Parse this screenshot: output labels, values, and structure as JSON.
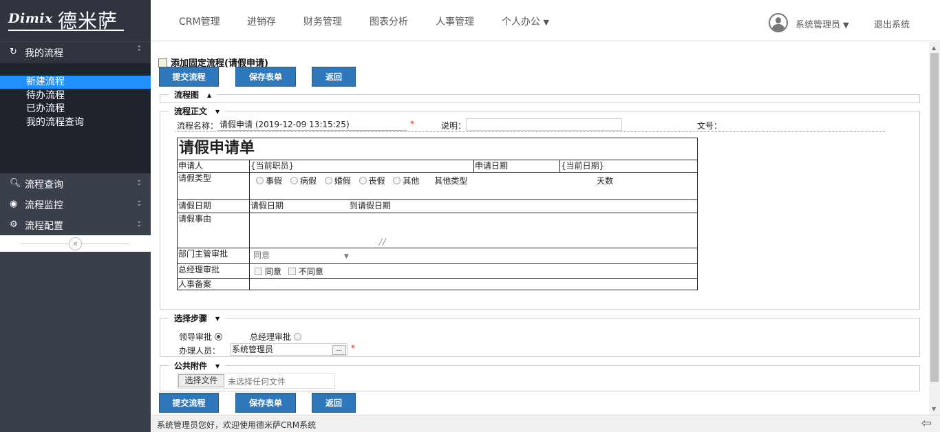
{
  "brand": {
    "logo_latin": "Dimix",
    "logo_cn": "德米萨"
  },
  "sidebar": {
    "my_flow": {
      "icon": "refresh-icon",
      "label": "我的流程"
    },
    "sub_items": [
      {
        "label": "新建流程",
        "active": true
      },
      {
        "label": "待办流程"
      },
      {
        "label": "已办流程"
      },
      {
        "label": "我的流程查询"
      }
    ],
    "sections": [
      {
        "icon": "search-icon",
        "label": "流程查询"
      },
      {
        "icon": "eye-icon",
        "label": "流程监控"
      },
      {
        "icon": "gear-icon",
        "label": "流程配置"
      }
    ],
    "collapse_glyph": "«"
  },
  "topnav": {
    "items": [
      "CRM管理",
      "进销存",
      "财务管理",
      "图表分析",
      "人事管理",
      "个人办公"
    ],
    "user": "系统管理员",
    "logout": "退出系统"
  },
  "page": {
    "title": "添加固定流程(请假申请)",
    "buttons": {
      "submit": "提交流程",
      "save": "保存表单",
      "back": "返回"
    },
    "sections": {
      "chart": "流程图",
      "body": "流程正文",
      "steps": "选择步骤",
      "attach": "公共附件"
    },
    "flow_name_label": "流程名称：",
    "flow_name_value": "请假申请 (2019-12-09 13:15:25)",
    "desc_label": "说明：",
    "desc_value": "",
    "docno_label": "文号：",
    "required_mark": "*"
  },
  "form": {
    "title": "请假申请单",
    "applicant_label": "申请人",
    "applicant_value": "{当前职员}",
    "apply_date_label": "申请日期",
    "apply_date_value": "{当前日期}",
    "leave_type_label": "请假类型",
    "leave_types": [
      "事假",
      "病假",
      "婚假",
      "丧假",
      "其他"
    ],
    "other_type_label": "其他类型",
    "days_label": "天数",
    "leave_date_label": "请假日期",
    "leave_date_from": "请假日期",
    "leave_date_to": "到请假日期",
    "reason_label": "请假事由",
    "dept_label": "部门主管审批",
    "dept_select": "同意",
    "gm_label": "总经理审批",
    "gm_options": [
      "同意",
      "不同意"
    ],
    "hr_label": "人事备案"
  },
  "steps": {
    "options": [
      {
        "label": "领导审批",
        "checked": true
      },
      {
        "label": "总经理审批",
        "checked": false
      }
    ],
    "handler_label": "办理人员：",
    "handler_value": "系统管理员",
    "handler_btn": "..."
  },
  "attach": {
    "choose_btn": "选择文件",
    "no_file": "未选择任何文件"
  },
  "footer": {
    "text": "系统管理员您好，欢迎使用德米萨CRM系统"
  }
}
